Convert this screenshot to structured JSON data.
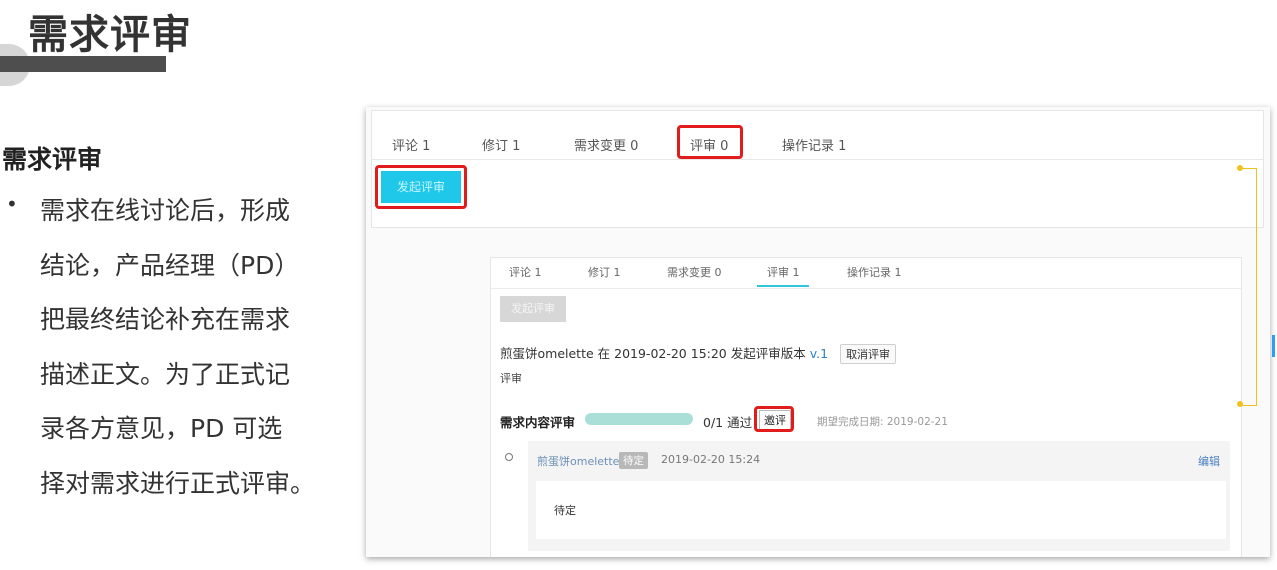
{
  "slide": {
    "title": "需求评审",
    "section_heading": "需求评审",
    "bullet_symbol": "•",
    "bullet_text": "需求在线讨论后，形成\n结论，产品经理（PD）\n把最终结论补充在需求\n描述正文。为了正式记\n录各方意见，PD 可选\n择对需求进行正式评审。"
  },
  "top_panel": {
    "tabs": [
      {
        "label": "评论 1"
      },
      {
        "label": "修订 1"
      },
      {
        "label": "需求变更 0"
      },
      {
        "label": "评审 0"
      },
      {
        "label": "操作记录 1"
      }
    ],
    "start_review_button": "发起评审"
  },
  "detail_panel": {
    "tabs": [
      {
        "label": "评论 1"
      },
      {
        "label": "修订 1"
      },
      {
        "label": "需求变更 0"
      },
      {
        "label": "评审 1"
      },
      {
        "label": "操作记录 1"
      }
    ],
    "start_review_button": "发起评审",
    "review_initiated": "煎蛋饼omelette 在 2019-02-20 15:20 发起评审版本",
    "version": "v.1",
    "cancel_review_button": "取消评审",
    "sub_label": "评审",
    "content_review_label": "需求内容评审",
    "progress_fraction": 0,
    "progress_text": "0/1 通过",
    "invite_button": "邀评",
    "due_date": "期望完成日期:   2019-02-21",
    "reviewer": {
      "name": "煎蛋饼omelette",
      "status": "待定",
      "time": "2019-02-20 15:24",
      "edit_link": "编辑",
      "comment": "待定"
    }
  },
  "colors": {
    "accent": "#1fc7e8",
    "highlight_box": "#e21b1b",
    "connector": "#f2c11d",
    "title_bar": "#4e4e4e"
  }
}
